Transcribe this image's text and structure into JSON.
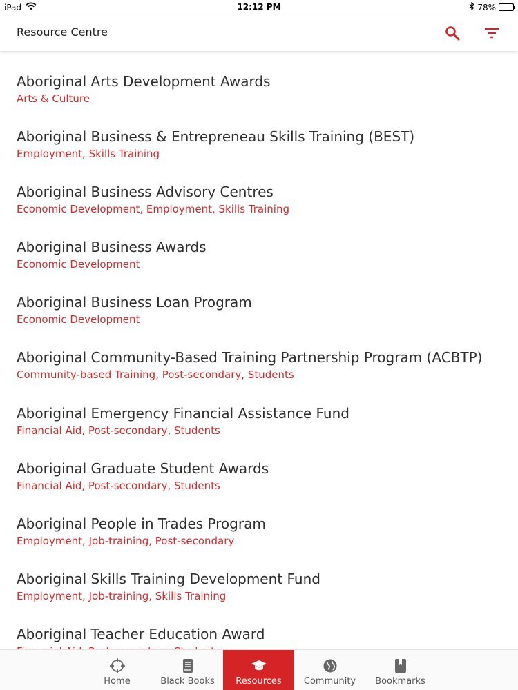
{
  "status": {
    "device": "iPad",
    "time": "12:12 PM",
    "battery": "78%",
    "battery_level": 0.78
  },
  "header": {
    "title": "Resource Centre"
  },
  "colors": {
    "accent": "#d42426",
    "category": "#d52b2b"
  },
  "resources": [
    {
      "name": "Aboriginal Arts Development Awards",
      "categories": "Arts & Culture"
    },
    {
      "name": "Aboriginal Business & Entrepreneau Skills Training (BEST)",
      "categories": "Employment, Skills Training"
    },
    {
      "name": "Aboriginal Business Advisory Centres",
      "categories": "Economic Development, Employment, Skills Training"
    },
    {
      "name": "Aboriginal Business Awards",
      "categories": "Economic Development"
    },
    {
      "name": "Aboriginal Business Loan Program",
      "categories": "Economic Development"
    },
    {
      "name": "Aboriginal Community-Based Training Partnership Program (ACBTP)",
      "categories": "Community-based Training, Post-secondary, Students"
    },
    {
      "name": "Aboriginal Emergency Financial Assistance Fund",
      "categories": "Financial Aid, Post-secondary, Students"
    },
    {
      "name": "Aboriginal Graduate Student Awards",
      "categories": "Financial Aid, Post-secondary, Students"
    },
    {
      "name": "Aboriginal People in Trades Program",
      "categories": "Employment, Job-training, Post-secondary"
    },
    {
      "name": "Aboriginal Skills Training Development Fund",
      "categories": "Employment, Job-training, Skills Training"
    },
    {
      "name": "Aboriginal Teacher Education Award",
      "categories": "Financial Aid, Post-secondary, Students"
    }
  ],
  "tabs": [
    {
      "label": "Home",
      "icon": "crosshair-icon",
      "active": false
    },
    {
      "label": "Black Books",
      "icon": "book-icon",
      "active": false
    },
    {
      "label": "Resources",
      "icon": "graduation-cap-icon",
      "active": true
    },
    {
      "label": "Community",
      "icon": "globe-icon",
      "active": false
    },
    {
      "label": "Bookmarks",
      "icon": "bookmark-icon",
      "active": false
    }
  ]
}
